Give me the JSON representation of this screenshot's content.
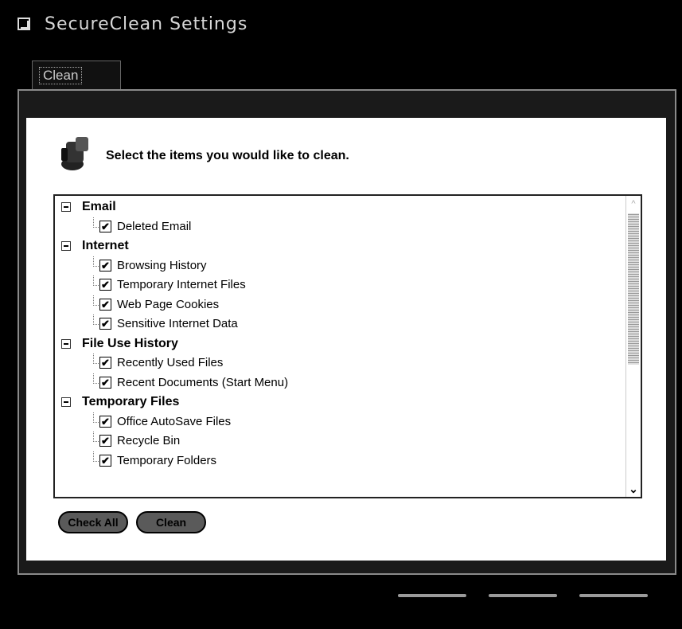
{
  "window": {
    "title": "SecureClean Settings",
    "icon": "app-window-icon"
  },
  "tabs": [
    {
      "label": "Clean"
    }
  ],
  "header": {
    "text": "Select the items you would like to clean.",
    "icon": "cleaner-icon"
  },
  "list": {
    "categories": [
      {
        "label": "Email",
        "items": [
          "Deleted Email"
        ]
      },
      {
        "label": "Internet",
        "items": [
          "Browsing History",
          "Temporary Internet Files",
          "Web Page Cookies",
          "Sensitive Internet Data"
        ]
      },
      {
        "label": "File Use History",
        "items": [
          "Recently Used Files",
          "Recent Documents (Start Menu)"
        ]
      },
      {
        "label": "Temporary Files",
        "items": [
          "Office AutoSave Files",
          "Recycle Bin",
          "Temporary Folders"
        ]
      }
    ],
    "checkmark": "✔"
  },
  "buttons": {
    "check_all": "Check All",
    "clean": "Clean"
  },
  "colors": {
    "background": "#000000",
    "panel": "#ffffff",
    "button": "#5a5a5a"
  }
}
